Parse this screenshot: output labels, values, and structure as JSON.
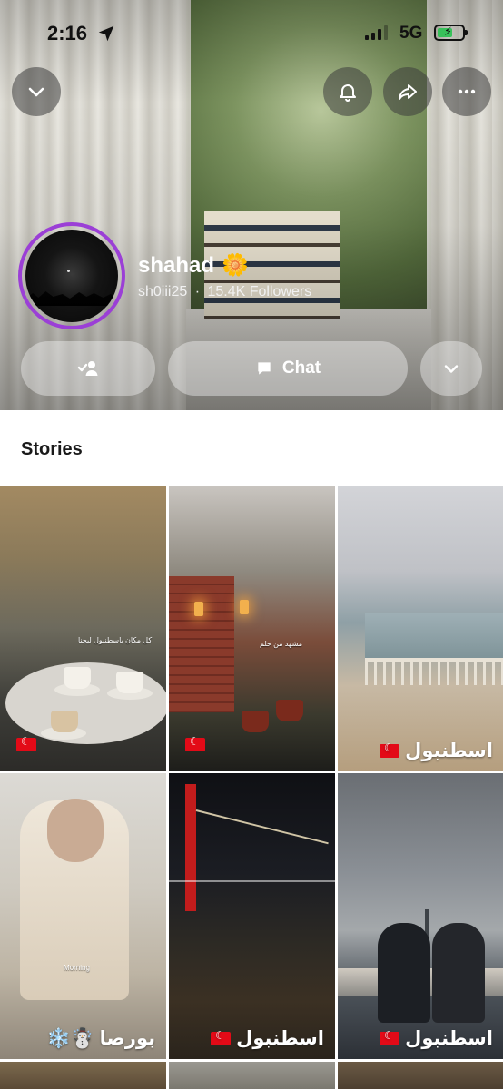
{
  "status_bar": {
    "time": "2:16",
    "network": "5G"
  },
  "profile": {
    "display_name": "shahad",
    "name_emoji": "🌼",
    "username": "sh0iii25",
    "separator": "·",
    "followers": "15.4K Followers"
  },
  "actions": {
    "chat_label": "Chat"
  },
  "stories": {
    "title": "Stories",
    "tiles": [
      {
        "caption": "",
        "overlay_text": "كل مكان باسطنبول ليجنا"
      },
      {
        "caption": "",
        "overlay_text": "مشهد من حلم"
      },
      {
        "caption": "اسطنبول",
        "overlay_text": ""
      },
      {
        "caption": "بورصا ☃️❄️",
        "overlay_text": "Morning"
      },
      {
        "caption": "اسطنبول",
        "overlay_text": ""
      },
      {
        "caption": "اسطنبول",
        "overlay_text": ""
      }
    ]
  },
  "colors": {
    "story_ring": "#9b3fd6",
    "turkey_flag": "#e30a17",
    "battery_charging": "#38c15a"
  }
}
